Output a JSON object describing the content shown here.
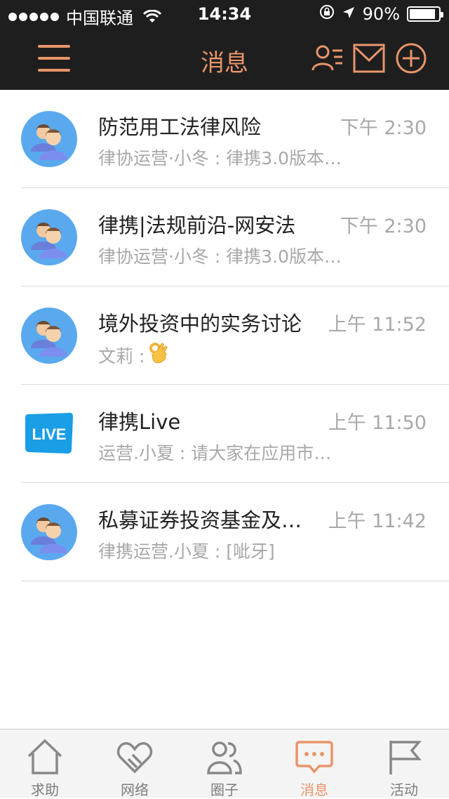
{
  "status_bar": {
    "carrier": "中国联通",
    "time": "14:34",
    "battery_text": "90%",
    "battery_level": 0.9
  },
  "nav": {
    "title": "消息",
    "accent_color": "#e8956a"
  },
  "messages": [
    {
      "title": "防范用工法律风险",
      "time": "下午 2:30",
      "preview": "律协运营·小冬 : 律携3.0版本…",
      "avatar": "group-avatar-icon"
    },
    {
      "title": "律携|法规前沿-网安法",
      "time": "下午 2:30",
      "preview": "律协运营·小冬 : 律携3.0版本…",
      "avatar": "group-avatar-icon"
    },
    {
      "title": "境外投资中的实务讨论",
      "time": "上午 11:52",
      "preview": "文莉 :",
      "avatar": "group-avatar-icon",
      "emoji": "ok-hand-emoji"
    },
    {
      "title": "律携Live",
      "time": "上午 11:50",
      "preview": "运营.小夏 : 请大家在应用市…",
      "avatar": "live-logo-icon",
      "logo_text": "LIVE"
    },
    {
      "title": "私募证券投资基金及…",
      "time": "上午 11:42",
      "preview": "律携运营.小夏 : [呲牙]",
      "avatar": "group-avatar-icon"
    }
  ],
  "tabs": [
    {
      "label": "求助",
      "icon": "home-icon"
    },
    {
      "label": "网络",
      "icon": "heart-link-icon"
    },
    {
      "label": "圈子",
      "icon": "people-icon"
    },
    {
      "label": "消息",
      "icon": "chat-bubble-icon",
      "active": true
    },
    {
      "label": "活动",
      "icon": "flag-icon"
    }
  ]
}
